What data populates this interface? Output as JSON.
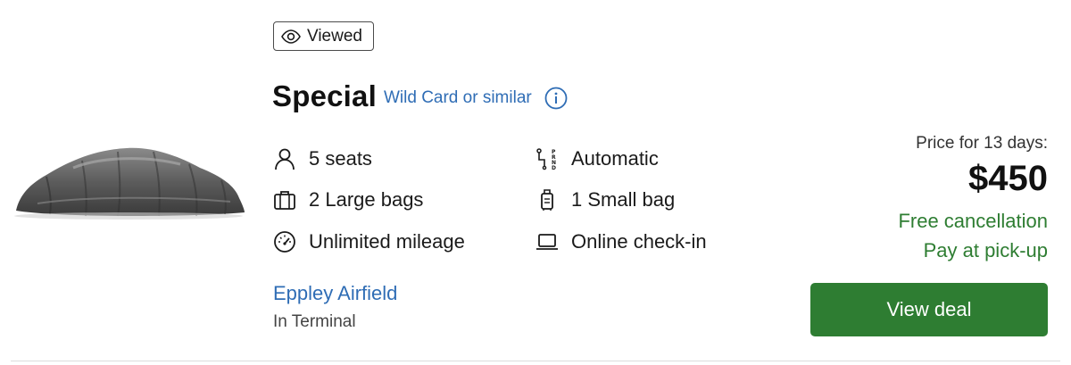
{
  "badge": {
    "label": "Viewed",
    "icon": "eye-icon"
  },
  "car": {
    "title": "Special",
    "model_link": "Wild Card or similar",
    "info_icon": "info-icon",
    "image_icon": "covered-car-icon"
  },
  "features": {
    "seats": "5 seats",
    "transmission": "Automatic",
    "large_bags": "2 Large bags",
    "small_bag": "1 Small bag",
    "mileage": "Unlimited mileage",
    "checkin": "Online check-in"
  },
  "location": {
    "name": "Eppley Airfield",
    "detail": "In Terminal"
  },
  "price": {
    "label": "Price for 13 days:",
    "amount": "$450",
    "free_cancellation": "Free cancellation",
    "pay_at_pickup": "Pay at pick-up"
  },
  "cta": {
    "label": "View deal"
  },
  "colors": {
    "link": "#2f6db5",
    "accent_green": "#2e7d32",
    "text": "#1a1a1a"
  }
}
